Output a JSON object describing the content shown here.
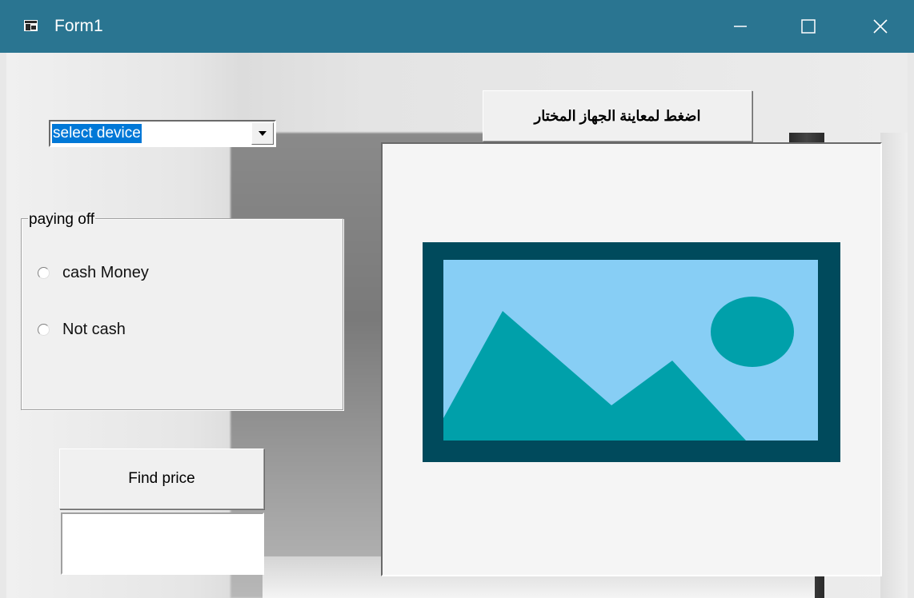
{
  "window": {
    "title": "Form1",
    "controls": [
      "minimize",
      "maximize",
      "close"
    ],
    "titlebar_color": "#2a7591"
  },
  "device_select": {
    "value": "select device"
  },
  "payment_group": {
    "legend": "paying off",
    "options": [
      {
        "label": "cash Money",
        "selected": false
      },
      {
        "label": "Not cash",
        "selected": false
      }
    ]
  },
  "buttons": {
    "find_price": "Find price",
    "preview_device": "اضغط لمعاينة الجهاز المختار"
  },
  "price_output": {
    "value": ""
  },
  "picture_box": {
    "placeholder_icon": "image-placeholder-icon",
    "colors": {
      "frame": "#004a5c",
      "sky": "#87cef5",
      "mountain": "#00a0aa",
      "sun": "#00a0aa"
    }
  }
}
